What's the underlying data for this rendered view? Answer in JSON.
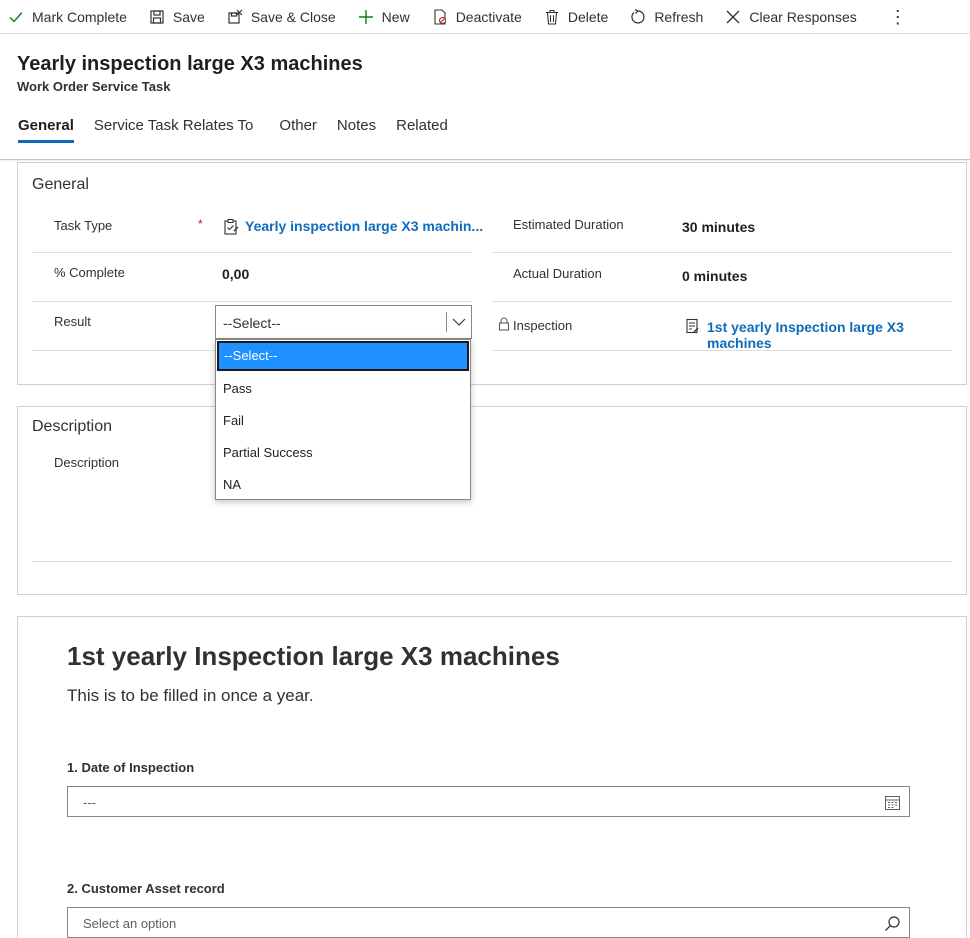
{
  "toolbar": {
    "mark_complete": "Mark Complete",
    "save": "Save",
    "save_close": "Save & Close",
    "new": "New",
    "deactivate": "Deactivate",
    "delete": "Delete",
    "refresh": "Refresh",
    "clear_responses": "Clear Responses",
    "more": "⋮"
  },
  "header": {
    "title": "Yearly inspection large X3 machines",
    "entity": "Work Order Service Task",
    "tabs": [
      "General",
      "Service Task Relates To",
      "Other",
      "Notes",
      "Related"
    ],
    "active_tab": "General"
  },
  "general": {
    "title": "General",
    "task_type_label": "Task Type",
    "required_marker": "*",
    "task_type_value": "Yearly inspection large X3 machin...",
    "percent_label": "% Complete",
    "percent_value": "0,00",
    "result_label": "Result",
    "result_value": "--Select--",
    "est_duration_label": "Estimated Duration",
    "est_duration_value": "30 minutes",
    "actual_duration_label": "Actual Duration",
    "actual_duration_value": "0 minutes",
    "inspection_label": "Inspection",
    "inspection_value": "1st yearly Inspection large X3 machines"
  },
  "result_options": [
    "--Select--",
    "Pass",
    "Fail",
    "Partial Success",
    "NA"
  ],
  "description": {
    "title": "Description",
    "label": "Description"
  },
  "inspection": {
    "title": "1st yearly Inspection large X3 machines",
    "subtitle": "This is to be filled in once a year.",
    "q1_label": "1. Date of Inspection",
    "q1_placeholder": "---",
    "q2_label": "2. Customer Asset record",
    "q2_placeholder": "Select an option"
  },
  "colors": {
    "accent": "#0f6cbd",
    "selected_option": "#1e90ff",
    "required": "#a4262c",
    "new_icon": "#107c10"
  }
}
